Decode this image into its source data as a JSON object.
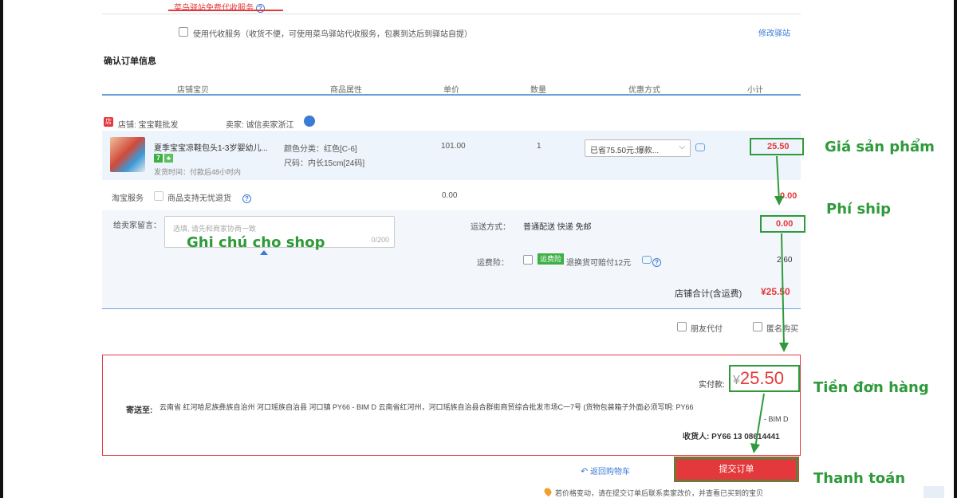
{
  "top_tab": {
    "label": "菜鸟驿站免费代收服务",
    "help": "?"
  },
  "proxy_service": {
    "label": "使用代收服务（收货不便，可使用菜鸟驿站代收服务，包裹到达后到驿站自提）",
    "change_link": "修改驿站"
  },
  "section_title": "确认订单信息",
  "table_headers": [
    "店铺宝贝",
    "商品属性",
    "单价",
    "数量",
    "优惠方式",
    "小计"
  ],
  "store": {
    "icon": "store-icon",
    "name": "店铺: 宝宝鞋批发",
    "seller": "卖家: 诚信卖家浙江"
  },
  "item": {
    "title": "夏季宝宝凉鞋包头1-3岁婴幼儿...",
    "tags": [
      "7",
      "♣"
    ],
    "ship_time": "发货时间：付款后48小时内",
    "attr_color": "颜色分类：红色[C-6]",
    "attr_size": "尺码：内长15cm[24码]",
    "unit_price": "101.00",
    "quantity": "1",
    "discount_select": "已省75.50元:爆款...",
    "subtotal": "25.50"
  },
  "taobao_service": {
    "label": "淘宝服务",
    "option": "商品支持无忧退货",
    "price": "0.00",
    "subtotal": "0.00"
  },
  "message": {
    "label": "给卖家留言：",
    "placeholder": "选填, 请先和商家协商一致",
    "counter": "0/200"
  },
  "shipping": {
    "label": "运送方式：",
    "value": "普通配送 快递 免邮",
    "price": "0.00"
  },
  "insurance": {
    "label": "运费险：",
    "tag": "运费险",
    "text": "退换货可赔付12元",
    "price": "2.60"
  },
  "store_total": {
    "label": "店铺合计(含运费)",
    "value": "¥25.50"
  },
  "options": {
    "friend_pay": "朋友代付",
    "anonymous": "匿名购买"
  },
  "payment": {
    "actual_label": "实付款:",
    "currency": "¥",
    "amount": "25.50",
    "address_label": "寄送至:",
    "address": "云南省 红河哈尼族彝族自治州 河口瑶族自治县 河口镇 PY66 - BIM D 云南省红河州，河口瑶族自治县合群街商贸综合批发市场C一7号 (货物包装箱子外面必须写明: PY66",
    "address_tail": "- BIM D",
    "receiver": "收货人: PY66 13 08614441"
  },
  "back_link": "返回购物车",
  "submit_button": "提交订单",
  "notice": "若价格变动，请在提交订单后联系卖家改价，并查看已买到的宝贝",
  "annotations": {
    "product_price": "Giá sản phẩm",
    "shipping_fee": "Phí ship",
    "shop_note": "Ghi chú cho shop",
    "order_total": "Tiền đơn hàng",
    "checkout": "Thanh toán"
  },
  "colors": {
    "accent_red": "#e4393c",
    "annotation_green": "#2e9a3a",
    "link_blue": "#3a7bd5"
  }
}
